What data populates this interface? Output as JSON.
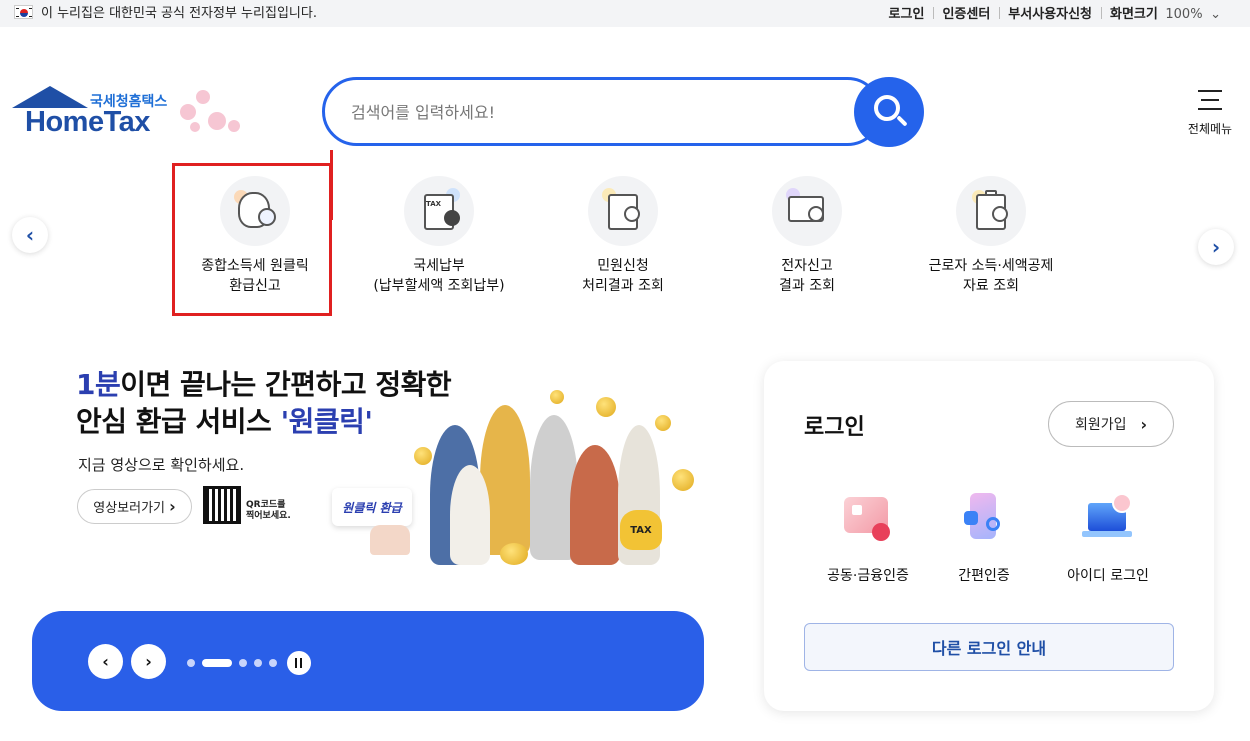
{
  "topbar": {
    "gov_notice": "이 누리집은 대한민국 공식 전자정부 누리집입니다.",
    "links": [
      "로그인",
      "인증센터",
      "부서사용자신청",
      "화면크기"
    ],
    "zoom": "100%",
    "zoom_arrow": "⌄"
  },
  "header": {
    "logo_sub": "국세청홈택스",
    "logo_main": "HomeTax",
    "search_placeholder": "검색어를 입력하세요!",
    "menu_label": "전체메뉴"
  },
  "quick_menu": {
    "prev_glyph": "‹",
    "next_glyph": "›",
    "items": [
      {
        "line1": "종합소득세 원클릭",
        "line2": "환급신고",
        "icon": "money-bag-check-icon"
      },
      {
        "line1": "국세납부",
        "line2": "(납부할세액 조회납부)",
        "icon": "tax-upload-icon"
      },
      {
        "line1": "민원신청",
        "line2": "처리결과 조회",
        "icon": "document-search-icon"
      },
      {
        "line1": "전자신고",
        "line2": "결과 조회",
        "icon": "monitor-search-icon"
      },
      {
        "line1": "근로자 소득·세액공제",
        "line2": "자료 조회",
        "icon": "clipboard-won-search-icon"
      }
    ]
  },
  "banner": {
    "title_blue1": "1분",
    "title_rest1": "이면 끝나는 간편하고 정확한",
    "title_rest2": "안심 환급 서비스 ",
    "title_blue2": "'원클릭'",
    "subtitle": "지금 영상으로 확인하세요.",
    "video_button": "영상보러가기",
    "video_chevron": "›",
    "qr_text_line1": "QR코드를",
    "qr_text_line2": "찍어보세요.",
    "oneclick_label": "원클릭 환급",
    "tax_bag_label": "TAX"
  },
  "carousel": {
    "prev_glyph": "‹",
    "next_glyph": "›",
    "slide_count": 5,
    "active_index": 1
  },
  "login": {
    "title": "로그인",
    "signup": "회원가입",
    "signup_chevron": "›",
    "options": [
      {
        "label": "공동·금융인증",
        "icon": "certificate-card-icon"
      },
      {
        "label": "간편인증",
        "icon": "phone-search-icon"
      },
      {
        "label": "아이디 로그인",
        "icon": "laptop-power-icon"
      }
    ],
    "other_login": "다른 로그인 안내"
  },
  "colors": {
    "brand_blue": "#2563eb",
    "logo_navy": "#1f4fa6",
    "highlight_red": "#e02020",
    "carousel_blue": "#2a5fe8"
  }
}
